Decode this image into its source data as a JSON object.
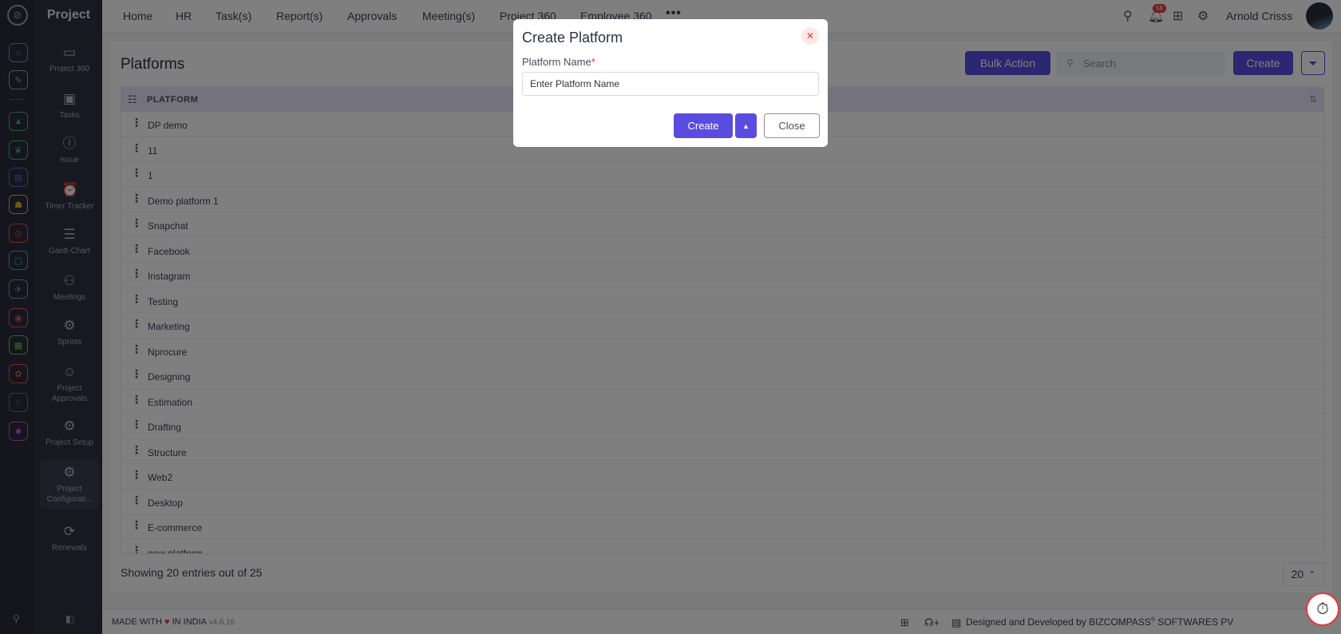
{
  "app": {
    "name": "Project"
  },
  "rail": {
    "icons": [
      {
        "name": "home-icon",
        "color": "#5b8def",
        "glyph": "⌂"
      },
      {
        "name": "pin-icon",
        "color": "#9aa0b5",
        "glyph": "✎"
      },
      {
        "name": "chart-icon",
        "color": "#3fb27f",
        "glyph": "▲"
      },
      {
        "name": "brain-icon",
        "color": "#3fb27f",
        "glyph": "❦"
      },
      {
        "name": "layers-icon",
        "color": "#7c5ce0",
        "glyph": "▤"
      },
      {
        "name": "people-icon",
        "color": "#f0a830",
        "glyph": "☗"
      },
      {
        "name": "target-icon",
        "color": "#e05555",
        "glyph": "◎"
      },
      {
        "name": "box-icon",
        "color": "#3fa8d8",
        "glyph": "▢"
      },
      {
        "name": "plane-icon",
        "color": "#7c8cf0",
        "glyph": "✈"
      },
      {
        "name": "chat-icon",
        "color": "#e05577",
        "glyph": "◉"
      },
      {
        "name": "doc-icon",
        "color": "#6cc050",
        "glyph": "▦"
      },
      {
        "name": "ribbon-icon",
        "color": "#e05555",
        "glyph": "✿"
      },
      {
        "name": "house-icon",
        "color": "#6a7080",
        "glyph": "⌂"
      },
      {
        "name": "gear-colored-icon",
        "color": "#d050c8",
        "glyph": "✹"
      }
    ]
  },
  "menu": {
    "items": [
      {
        "label": "Project 360",
        "icon": "briefcase-icon",
        "glyph": "▭"
      },
      {
        "label": "Tasks",
        "icon": "clipboard-icon",
        "glyph": "▣"
      },
      {
        "label": "Issue",
        "icon": "alert-icon",
        "glyph": "ⓘ"
      },
      {
        "label": "Timer Tracker",
        "icon": "alarm-icon",
        "glyph": "⏰"
      },
      {
        "label": "Gantt-Chart",
        "icon": "gantt-icon",
        "glyph": "☰"
      },
      {
        "label": "Meetings",
        "icon": "meetings-icon",
        "glyph": "⚇"
      },
      {
        "label": "Sprints",
        "icon": "sprint-gear-icon",
        "glyph": "⚙"
      },
      {
        "label": "Project Approvals",
        "icon": "approval-icon",
        "glyph": "☺"
      },
      {
        "label": "Project Setup",
        "icon": "setup-gear-icon",
        "glyph": "⚙"
      },
      {
        "label": "Project Configurati...",
        "icon": "config-gear-icon",
        "glyph": "⚙"
      },
      {
        "label": "Renewals",
        "icon": "refresh-icon",
        "glyph": "⟳"
      }
    ]
  },
  "topnav": {
    "items": [
      "Home",
      "HR",
      "Task(s)",
      "Report(s)",
      "Approvals",
      "Meeting(s)",
      "Project 360",
      "Employee 360"
    ],
    "more": "•••",
    "notification_count": "58",
    "user_name": "Arnold Crisss"
  },
  "page": {
    "title": "Platforms",
    "bulk_action": "Bulk Action",
    "search_placeholder": "Search",
    "create_label": "Create"
  },
  "table": {
    "column": "PLATFORM",
    "rows": [
      "DP demo",
      "11",
      "1",
      "Demo platform 1",
      "Snapchat",
      "Facebook",
      "Instagram",
      "Testing",
      "Marketing",
      "Nprocure",
      "Designing",
      "Estimation",
      "Drafting",
      "Structure",
      "Web2",
      "Desktop",
      "E-commerce",
      "new platform"
    ]
  },
  "pagination": {
    "showing": "Showing 20 entries out of 25",
    "page_size": "20"
  },
  "footer": {
    "made_with": "MADE WITH",
    "in_india": "IN INDIA",
    "version": "v4.6.16",
    "credit": "Designed and Developed by  BIZCOMPASS",
    "reg": "®",
    "company": " SOFTWARES PV"
  },
  "modal": {
    "title": "Create Platform",
    "field_label": "Platform Name",
    "required_mark": "*",
    "placeholder": "Enter Platform Name",
    "create_label": "Create",
    "close_label": "Close"
  },
  "colors": {
    "accent": "#5b4ce0",
    "danger": "#e53935"
  }
}
